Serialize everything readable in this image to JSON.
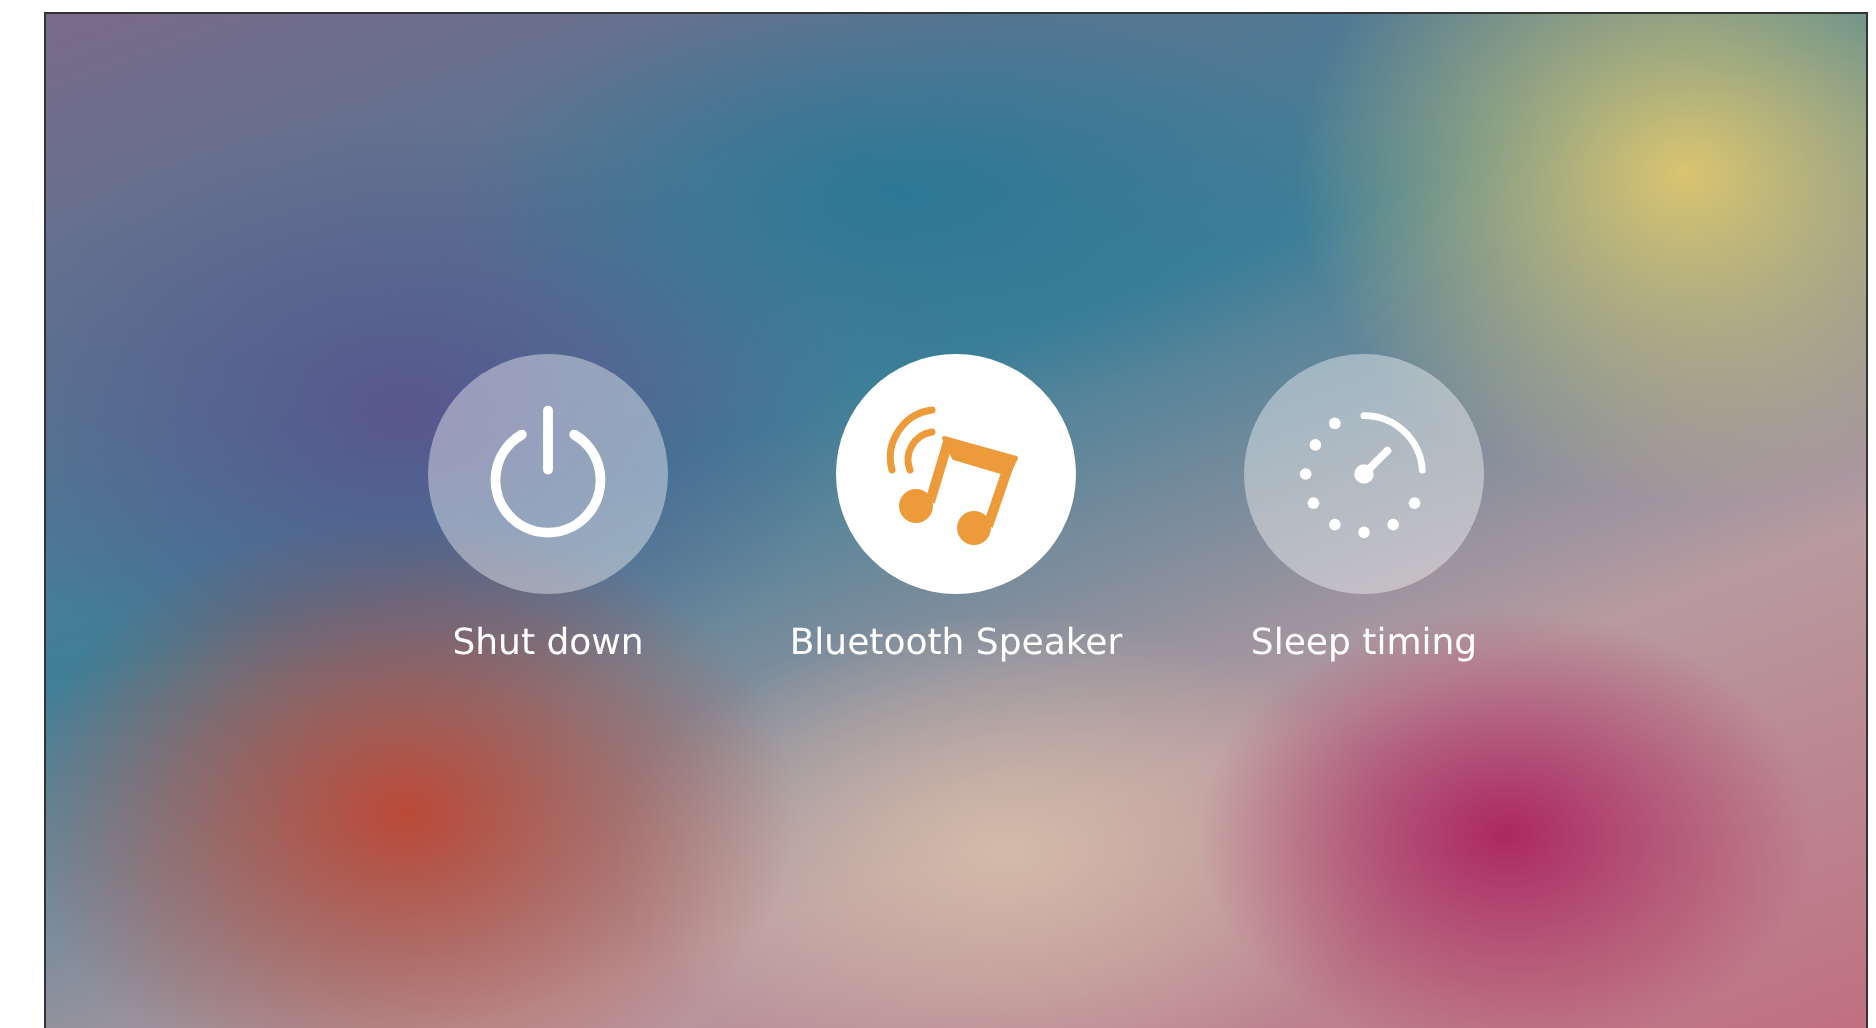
{
  "items": [
    {
      "kind": "power",
      "label": "Shut down",
      "selected": false
    },
    {
      "kind": "music",
      "label": "Bluetooth Speaker",
      "selected": true
    },
    {
      "kind": "timer",
      "label": "Sleep timing",
      "selected": false
    }
  ]
}
